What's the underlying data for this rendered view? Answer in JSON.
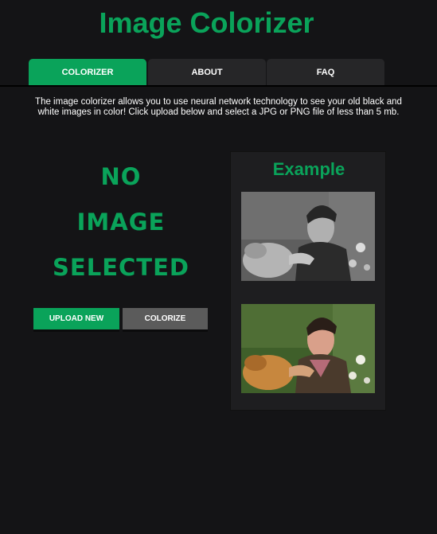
{
  "app": {
    "title": "Image Colorizer"
  },
  "tabs": [
    {
      "label": "COLORIZER",
      "active": true
    },
    {
      "label": "ABOUT",
      "active": false
    },
    {
      "label": "FAQ",
      "active": false
    }
  ],
  "intro": "The image colorizer allows you to use neural network technology to see your old black and white images in color! Click upload below and select a JPG or PNG file of less than 5 mb.",
  "preview": {
    "lines": [
      "NO",
      "IMAGE",
      "SELECTED"
    ]
  },
  "buttons": {
    "upload_label": "UPLOAD NEW",
    "colorize_label": "COLORIZE"
  },
  "example": {
    "title": "Example"
  },
  "colors": {
    "accent": "#0aa35a",
    "background": "#141416",
    "tab_inactive": "#262628",
    "button_gray": "#5b5b5b"
  }
}
